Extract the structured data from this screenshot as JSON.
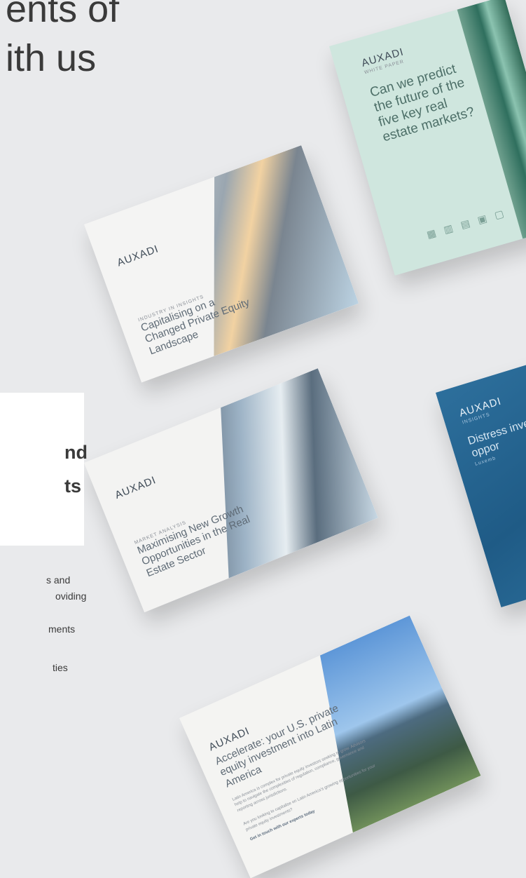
{
  "headline": {
    "line1": "ents of",
    "line2": "ith us"
  },
  "panel": {
    "heading_line1": "nd",
    "heading_line2": "ts",
    "lines": [
      "s and",
      "oviding",
      "ments",
      "ties"
    ]
  },
  "covers": {
    "white_paper": {
      "brand": "AUXADI",
      "eyebrow": "WHITE PAPER",
      "title": "Can we predict the future of the five key real estate markets?"
    },
    "private_equity": {
      "brand": "AUXADI",
      "eyebrow": "INDUSTRY IN INSIGHTS",
      "title": "Capitalising on a Changed Private Equity Landscape"
    },
    "market_analysis": {
      "brand": "AUXADI",
      "eyebrow": "MARKET ANALYSIS",
      "title": "Maximising New Growth Opportunities in the Real Estate Sector"
    },
    "insights": {
      "brand": "AUXADI",
      "eyebrow": "INSIGHTS",
      "title": "Distress investm oppor",
      "subtitle": "Luxemb"
    },
    "latin_america": {
      "brand": "AUXADI",
      "title": "Accelerate: your U.S. private equity investment into Latin America",
      "body": "Latin America is complex for private equity investors seeking to grow. Advisors help to navigate the complexities of regulation, compliance, governance and reporting across jurisdictions.",
      "question": "Are you looking to capitalise on Latin America's growing opportunities for your private equity investments?",
      "cta": "Get in touch with our experts today"
    }
  }
}
